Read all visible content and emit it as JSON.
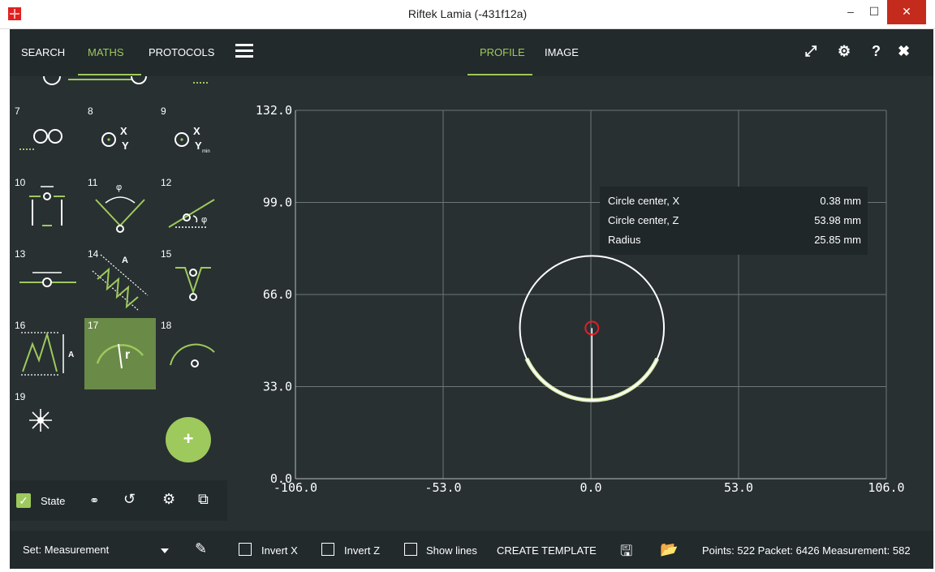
{
  "window": {
    "title": "Riftek Lamia (-431f12a)",
    "min": "‒",
    "max": "☐",
    "close": "✕"
  },
  "sidebar": {
    "tabs": [
      "SEARCH",
      "MATHS",
      "PROTOCOLS"
    ],
    "active_tab": "MATHS",
    "tiles": [
      "7",
      "8",
      "9",
      "10",
      "11",
      "12",
      "13",
      "14",
      "15",
      "16",
      "17",
      "18",
      "19"
    ],
    "selected_tile": "17",
    "fab_label": "+",
    "state_label": "State",
    "set_label": "Set: Measurement"
  },
  "topbar": {
    "tabs": [
      "PROFILE",
      "IMAGE"
    ],
    "active_tab": "PROFILE"
  },
  "tooltip": {
    "rows": [
      {
        "label": "Circle center, X",
        "value": "0.38 mm"
      },
      {
        "label": "Circle center, Z",
        "value": "53.98 mm"
      },
      {
        "label": "Radius",
        "value": "25.85 mm"
      }
    ]
  },
  "chart_data": {
    "type": "scatter",
    "xlim": [
      -106.0,
      106.0
    ],
    "ylim": [
      0.0,
      132.0
    ],
    "x_ticks": [
      "-106.0",
      "-53.0",
      "0.0",
      "53.0",
      "106.0"
    ],
    "y_ticks": [
      "0.0",
      "33.0",
      "66.0",
      "99.0",
      "132.0"
    ],
    "grid": true,
    "fitted_circle": {
      "cx": 0.38,
      "cz": 53.98,
      "r": 25.85
    },
    "profile_arc_deg": [
      205,
      335
    ],
    "colors": {
      "circle": "#ffffff",
      "profile": "#d8ecaa",
      "center": "#e0202a",
      "grid": "#6e7678",
      "axis": "#b8bcbd"
    }
  },
  "bottombar": {
    "invert_x": "Invert X",
    "invert_z": "Invert Z",
    "show_lines": "Show lines",
    "create_template": "CREATE TEMPLATE",
    "status": "Points: 522  Packet: 6426  Measurement: 582"
  },
  "colors": {
    "accent": "#9ec95c",
    "panel": "#283032",
    "bar": "#222a2c"
  }
}
